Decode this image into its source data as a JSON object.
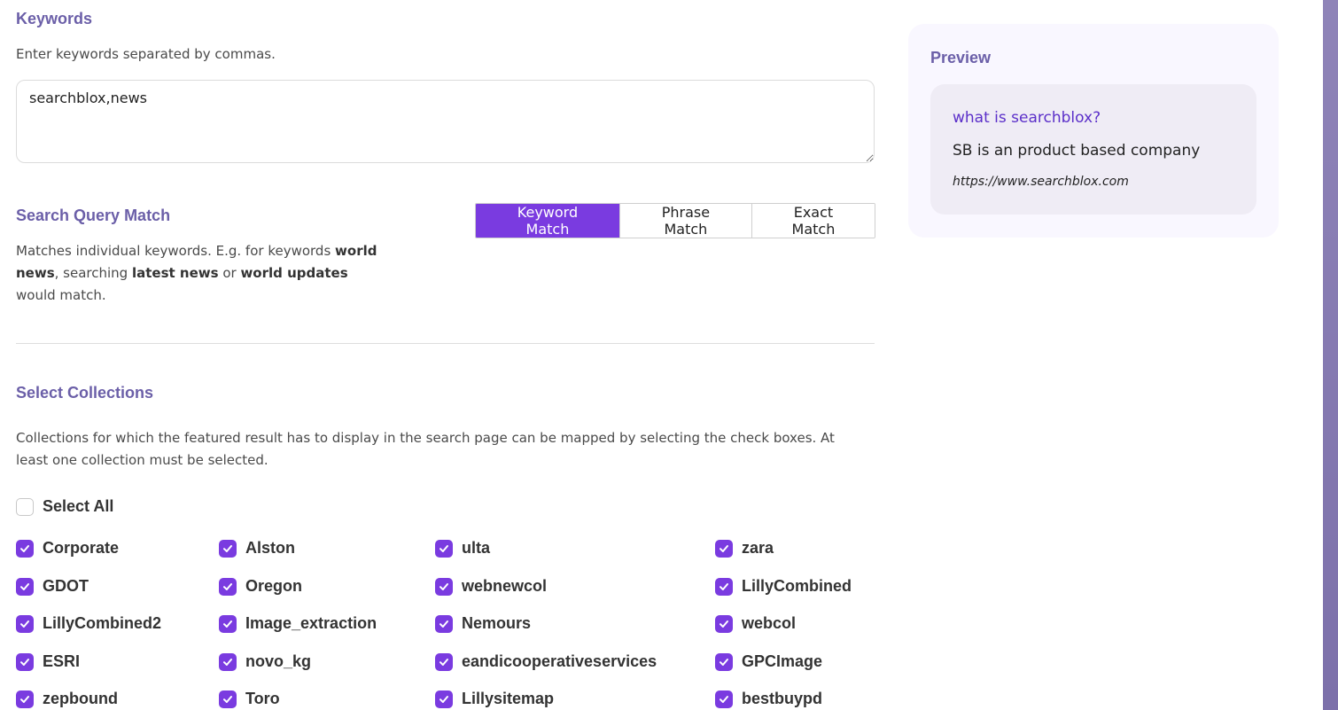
{
  "keywords": {
    "title": "Keywords",
    "help": "Enter keywords separated by commas.",
    "value": "searchblox,news"
  },
  "query_match": {
    "title": "Search Query Match",
    "help_parts": [
      {
        "text": "Matches individual keywords. E.g. for keywords ",
        "bold": false
      },
      {
        "text": "world news",
        "bold": true
      },
      {
        "text": ", searching ",
        "bold": false
      },
      {
        "text": "latest news",
        "bold": true
      },
      {
        "text": " or ",
        "bold": false
      },
      {
        "text": "world updates",
        "bold": true
      },
      {
        "text": " would match.",
        "bold": false
      }
    ],
    "options": [
      {
        "label": "Keyword Match",
        "active": true
      },
      {
        "label": "Phrase Match",
        "active": false
      },
      {
        "label": "Exact Match",
        "active": false
      }
    ]
  },
  "collections": {
    "title": "Select Collections",
    "help": "Collections for which the featured result has to display in the search page can be mapped by selecting the check boxes. At least one collection must be selected.",
    "select_all_label": "Select All",
    "select_all_checked": false,
    "columns": [
      [
        "Corporate",
        "GDOT",
        "LillyCombined2",
        "ESRI",
        "zepbound"
      ],
      [
        "Alston",
        "Oregon",
        "Image_extraction",
        "novo_kg",
        "Toro"
      ],
      [
        "ulta",
        "webnewcol",
        "Nemours",
        "eandicooperativeservices",
        "Lillysitemap"
      ],
      [
        "zara",
        "LillyCombined",
        "webcol",
        "GPCImage",
        "bestbuypd"
      ]
    ]
  },
  "preview": {
    "title": "Preview",
    "result_title": "what is searchblox?",
    "result_description": "SB is an product based company",
    "result_url": "https://www.searchblox.com"
  },
  "colors": {
    "accent": "#7a3be0",
    "heading": "#6b5fa8",
    "link": "#5b2fc9"
  },
  "icons": {
    "checkbox_checked": "check-icon"
  }
}
